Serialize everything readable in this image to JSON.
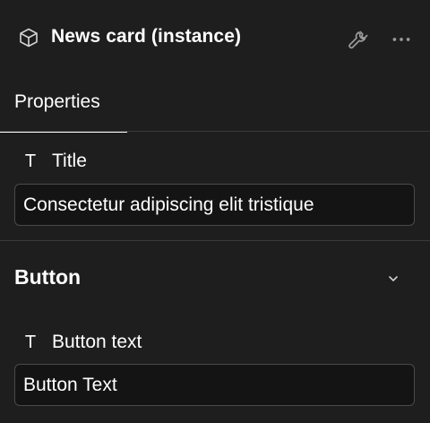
{
  "header": {
    "title": "News card (instance)",
    "component_icon": "component-cube-icon",
    "wrench_icon": "wrench-icon",
    "more_icon": "more-horizontal-icon"
  },
  "tabs": [
    {
      "label": "Properties",
      "active": true
    }
  ],
  "title_property": {
    "type_icon": "T",
    "label": "Title",
    "value": "Consectetur adipiscing elit tristique"
  },
  "button_section": {
    "title": "Button",
    "chevron_icon": "chevron-down-icon",
    "expanded": true,
    "property": {
      "type_icon": "T",
      "label": "Button text",
      "value": "Button Text"
    }
  },
  "colors": {
    "background": "#1e1e1e",
    "input_background": "#141414",
    "border": "#4a4a4a",
    "divider": "#3a3a3a",
    "text": "#ffffff",
    "icon_muted": "#9a9a9a"
  }
}
